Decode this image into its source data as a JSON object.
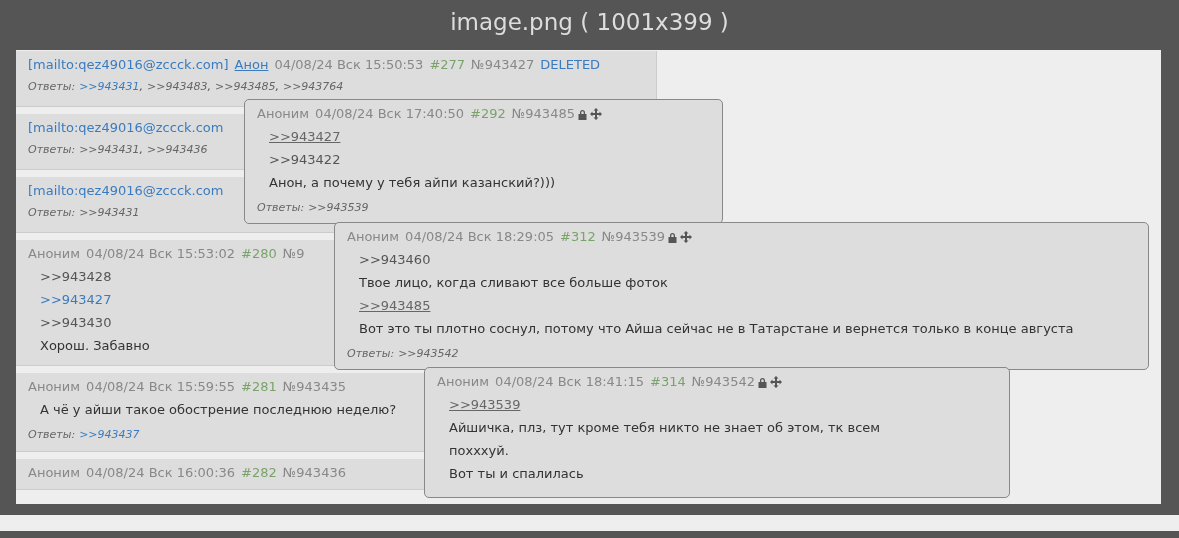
{
  "viewer": {
    "title": "image.png ( 1001x399 )"
  },
  "posts": [
    {
      "header": [
        {
          "kind": "mail",
          "text": "[mailto:qez49016@zccck.com]"
        },
        {
          "kind": "name",
          "text": "Анон"
        },
        {
          "kind": "date",
          "text": "04/08/24 Вск 15:50:53"
        },
        {
          "kind": "num",
          "text": "#277"
        },
        {
          "kind": "id",
          "text": "№943427"
        },
        {
          "kind": "deleted",
          "text": "DELETED"
        }
      ],
      "replies_label": "Ответы:",
      "replies": [
        {
          "text": ">>943431",
          "kind": "link",
          "sep": ","
        },
        {
          "text": ">>943483",
          "kind": "plain",
          "sep": ","
        },
        {
          "text": ">>943485",
          "kind": "plain",
          "sep": ","
        },
        {
          "text": ">>943764",
          "kind": "plain"
        }
      ]
    },
    {
      "header": [
        {
          "kind": "mail",
          "text": "[mailto:qez49016@zccck.com"
        }
      ],
      "replies_label": "Ответы:",
      "replies": [
        {
          "text": ">>943431",
          "kind": "plain",
          "sep": ","
        },
        {
          "text": ">>943436",
          "kind": "plain"
        }
      ]
    },
    {
      "header": [
        {
          "kind": "mail",
          "text": "[mailto:qez49016@zccck.com"
        }
      ],
      "replies_label": "Ответы:",
      "replies": [
        {
          "text": ">>943431",
          "kind": "plain"
        }
      ]
    },
    {
      "header": [
        {
          "kind": "author",
          "text": "Аноним"
        },
        {
          "kind": "date",
          "text": "04/08/24 Вск 15:53:02"
        },
        {
          "kind": "num",
          "text": "#280"
        },
        {
          "kind": "id",
          "text": "№9"
        }
      ],
      "lines": [
        {
          "kind": "quote",
          "text": ">>943428"
        },
        {
          "kind": "link",
          "text": ">>943427"
        },
        {
          "kind": "quote",
          "text": ">>943430"
        },
        {
          "kind": "text",
          "text": "Хорош. Забавно"
        }
      ]
    },
    {
      "header": [
        {
          "kind": "author",
          "text": "Аноним"
        },
        {
          "kind": "date",
          "text": "04/08/24 Вск 15:59:55"
        },
        {
          "kind": "num",
          "text": "#281"
        },
        {
          "kind": "id",
          "text": "№943435"
        }
      ],
      "lines": [
        {
          "kind": "text",
          "text": "А чё у айши такое обострение последнюю неделю?"
        }
      ],
      "replies_label": "Ответы:",
      "replies": [
        {
          "text": ">>943437",
          "kind": "link"
        }
      ]
    },
    {
      "header": [
        {
          "kind": "author",
          "text": "Аноним"
        },
        {
          "kind": "date",
          "text": "04/08/24 Вск 16:00:36"
        },
        {
          "kind": "num",
          "text": "#282"
        },
        {
          "kind": "id",
          "text": "№943436"
        }
      ]
    }
  ],
  "popups": [
    {
      "header": [
        {
          "kind": "author",
          "text": "Аноним"
        },
        {
          "kind": "date",
          "text": "04/08/24 Вск 17:40:50"
        },
        {
          "kind": "num",
          "text": "#292"
        },
        {
          "kind": "id",
          "text": "№943485"
        }
      ],
      "lines": [
        {
          "kind": "hover",
          "text": ">>943427"
        },
        {
          "kind": "quote",
          "text": ">>943422"
        },
        {
          "kind": "text",
          "text": "Анон, а почему у тебя айпи казанский?)))"
        }
      ],
      "replies_label": "Ответы:",
      "replies": [
        {
          "text": ">>943539",
          "kind": "plain"
        }
      ]
    },
    {
      "header": [
        {
          "kind": "author",
          "text": "Аноним"
        },
        {
          "kind": "date",
          "text": "04/08/24 Вск 18:29:05"
        },
        {
          "kind": "num",
          "text": "#312"
        },
        {
          "kind": "id",
          "text": "№943539"
        }
      ],
      "lines": [
        {
          "kind": "quote",
          "text": ">>943460"
        },
        {
          "kind": "text",
          "text": "Твое лицо, когда сливают все больше фоток"
        },
        {
          "kind": "hover",
          "text": ">>943485"
        },
        {
          "kind": "text",
          "text": "Вот это ты плотно соснул, потому что Айша сейчас не в Татарстане и вернется только в конце августа"
        }
      ],
      "replies_label": "Ответы:",
      "replies": [
        {
          "text": ">>943542",
          "kind": "plain"
        }
      ]
    },
    {
      "header": [
        {
          "kind": "author",
          "text": "Аноним"
        },
        {
          "kind": "date",
          "text": "04/08/24 Вск 18:41:15"
        },
        {
          "kind": "num",
          "text": "#314"
        },
        {
          "kind": "id",
          "text": "№943542"
        }
      ],
      "lines": [
        {
          "kind": "hover",
          "text": ">>943539"
        },
        {
          "kind": "text",
          "text": "Айшичка, плз, тут кроме тебя никто не знает об этом, тк всем похххуй."
        },
        {
          "kind": "text",
          "text": "Вот ты и спалилась"
        }
      ]
    }
  ]
}
